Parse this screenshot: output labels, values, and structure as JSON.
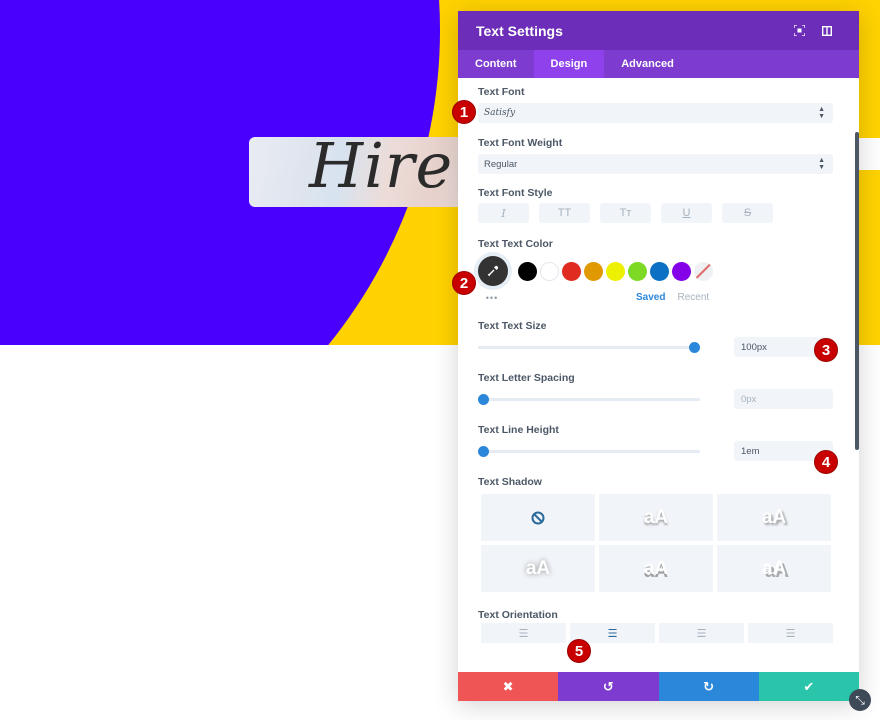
{
  "hero": {
    "headline": "Hire m",
    "colors": {
      "purple": "#4a00fd",
      "yellow": "#ffd200"
    }
  },
  "panel": {
    "title": "Text Settings",
    "header_icons": [
      "focus-icon",
      "sidebar-toggle-icon"
    ],
    "tabs": [
      {
        "label": "Content",
        "active": false
      },
      {
        "label": "Design",
        "active": true
      },
      {
        "label": "Advanced",
        "active": false
      }
    ],
    "text_font": {
      "label": "Text Font",
      "value": "Satisfy"
    },
    "text_font_weight": {
      "label": "Text Font Weight",
      "value": "Regular"
    },
    "text_font_style": {
      "label": "Text Font Style",
      "buttons": [
        {
          "name": "italic",
          "glyph": "I"
        },
        {
          "name": "uppercase",
          "glyph": "TT"
        },
        {
          "name": "capitalize",
          "glyph": "Tт"
        },
        {
          "name": "underline",
          "glyph": "U"
        },
        {
          "name": "strikethrough",
          "glyph": "S"
        }
      ]
    },
    "text_color": {
      "label": "Text Text Color",
      "swatches": [
        "#000000",
        "#ffffff",
        "#e02b20",
        "#e09900",
        "#edf000",
        "#7cda24",
        "#0c71c3",
        "#8300e9"
      ],
      "saved_label": "Saved",
      "recent_label": "Recent",
      "more": "•••"
    },
    "text_size": {
      "label": "Text Text Size",
      "value": "100px",
      "slider_fraction": 1.0
    },
    "letter_spacing": {
      "label": "Text Letter Spacing",
      "value": "0px",
      "slider_fraction": 0.0
    },
    "line_height": {
      "label": "Text Line Height",
      "value": "1em",
      "slider_fraction": 0.0
    },
    "text_shadow": {
      "label": "Text Shadow",
      "options": [
        "none",
        "aA",
        "aA",
        "aA",
        "aA",
        "aA"
      ]
    },
    "text_orientation": {
      "label": "Text Orientation",
      "options": [
        "left",
        "center",
        "right",
        "justify"
      ],
      "selected": "center"
    },
    "footer": {
      "buttons": [
        {
          "name": "discard",
          "glyph": "✖",
          "color": "#ef5555"
        },
        {
          "name": "undo",
          "glyph": "↺",
          "color": "#7e3bd0"
        },
        {
          "name": "redo",
          "glyph": "↻",
          "color": "#2b87da"
        },
        {
          "name": "save",
          "glyph": "✔",
          "color": "#29c4a9"
        }
      ]
    }
  },
  "annotations": [
    "1",
    "2",
    "3",
    "4",
    "5"
  ]
}
